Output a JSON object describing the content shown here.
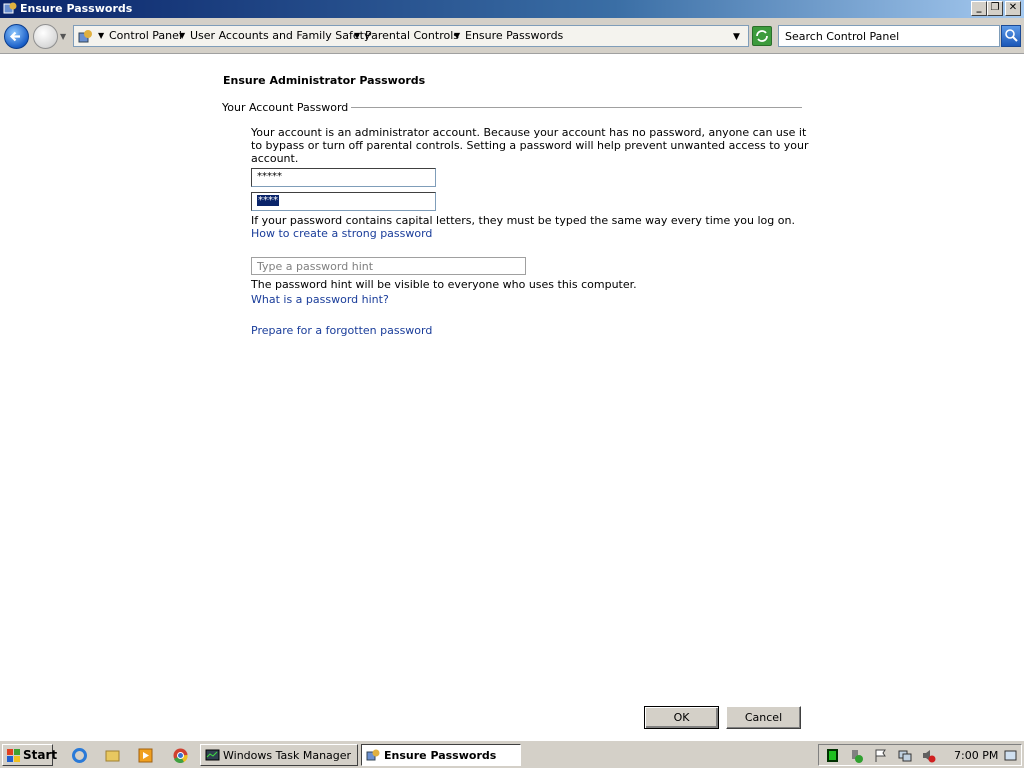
{
  "window": {
    "title": "Ensure Passwords",
    "minimize": "_",
    "maximize": "❐",
    "close": "✕"
  },
  "address_bar": {
    "breadcrumbs": [
      "Control Panel",
      "User Accounts and Family Safety",
      "Parental Controls",
      "Ensure Passwords"
    ],
    "search_placeholder": "Search Control Panel"
  },
  "content": {
    "heading": "Ensure Administrator Passwords",
    "group_label": "Your Account Password",
    "description": "Your account is an administrator account. Because your account has no password, anyone can use it to bypass or turn off parental controls. Setting a password will help prevent unwanted access to your account.",
    "password_value": "*****",
    "confirm_value": "****",
    "caps_note": "If your password contains capital letters, they must be typed the same way every time you log on.",
    "strong_password_link": "How to create a strong password",
    "hint_placeholder": "Type a password hint",
    "hint_note": "The password hint will be visible to everyone who uses this computer.",
    "what_is_hint_link": "What is a password hint?",
    "forgot_link": "Prepare for a forgotten password",
    "ok_label": "OK",
    "cancel_label": "Cancel"
  },
  "taskbar": {
    "start_label": "Start",
    "quick_launch": [
      "internet-explorer-icon",
      "folder-icon",
      "media-player-icon",
      "chrome-icon"
    ],
    "tasks": [
      {
        "label": "Windows Task Manager",
        "active": false
      },
      {
        "label": "Ensure Passwords",
        "active": true
      }
    ],
    "clock": "7:00 PM"
  },
  "colors": {
    "title_bar": "#0a246a",
    "link": "#1a3d9a",
    "selection": "#0a246a"
  }
}
